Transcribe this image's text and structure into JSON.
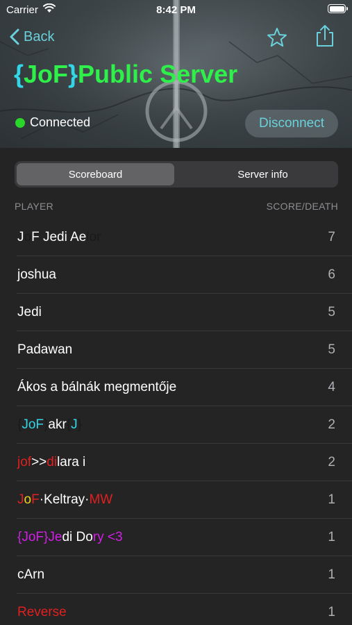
{
  "status_bar": {
    "carrier": "Carrier",
    "time": "8:42 PM"
  },
  "nav": {
    "back_label": "Back"
  },
  "server": {
    "title_segments": [
      {
        "text": "{",
        "color": "#33d6e6"
      },
      {
        "text": "JoF",
        "color": "#2ff04a"
      },
      {
        "text": "}",
        "color": "#33d6e6"
      },
      {
        "text": "Public Server",
        "color": "#2ff04a"
      }
    ],
    "status": "Connected",
    "disconnect_label": "Disconnect"
  },
  "tabs": {
    "active": "Scoreboard",
    "inactive": "Server info"
  },
  "columns": {
    "player": "PLAYER",
    "score": "SCORE/DEATH"
  },
  "colors": {
    "accent": "#6ad1dc",
    "connected": "#2bd62b",
    "background": "#242424"
  },
  "players": [
    {
      "score": "7",
      "name_segments": [
        {
          "text": "J",
          "color": "#ffffff"
        },
        {
          "text": "o",
          "color": "#1a1a1a"
        },
        {
          "text": "F Jedi Ae",
          "color": "#ffffff"
        },
        {
          "text": "lor",
          "color": "#1a1a1a"
        }
      ]
    },
    {
      "score": "6",
      "name_segments": [
        {
          "text": "joshua",
          "color": "#ffffff"
        }
      ]
    },
    {
      "score": "5",
      "name_segments": [
        {
          "text": "Jedi",
          "color": "#ffffff"
        }
      ]
    },
    {
      "score": "5",
      "name_segments": [
        {
          "text": "Padawan",
          "color": "#ffffff"
        }
      ]
    },
    {
      "score": "4",
      "name_segments": [
        {
          "text": "Ákos a bálnák megmentője",
          "color": "#ffffff"
        }
      ]
    },
    {
      "score": "2",
      "name_segments": [
        {
          "text": "{",
          "color": "#1a1a1a"
        },
        {
          "text": "JoF",
          "color": "#33d6e6"
        },
        {
          "text": "}",
          "color": "#1a1a1a"
        },
        {
          "text": "akr",
          "color": "#ffffff"
        },
        {
          "text": "{",
          "color": "#1a1a1a"
        },
        {
          "text": "J",
          "color": "#33d6e6"
        },
        {
          "text": "}",
          "color": "#1a1a1a"
        }
      ]
    },
    {
      "score": "2",
      "name_segments": [
        {
          "text": "jof",
          "color": "#e02020"
        },
        {
          "text": ">>",
          "color": "#ffffff"
        },
        {
          "text": "di",
          "color": "#e02020"
        },
        {
          "text": "lara i",
          "color": "#ffffff"
        }
      ]
    },
    {
      "score": "1",
      "name_segments": [
        {
          "text": "J",
          "color": "#e02020"
        },
        {
          "text": "o",
          "color": "#f0d21e"
        },
        {
          "text": "F",
          "color": "#e02020"
        },
        {
          "text": "·Keltray·",
          "color": "#ffffff"
        },
        {
          "text": "MW",
          "color": "#e02020"
        }
      ]
    },
    {
      "score": "1",
      "name_segments": [
        {
          "text": "{JoF}",
          "color": "#d21ee6"
        },
        {
          "text": "Je",
          "color": "#d21ee6"
        },
        {
          "text": "di Do",
          "color": "#ffffff"
        },
        {
          "text": "ry <3",
          "color": "#d21ee6"
        }
      ]
    },
    {
      "score": "1",
      "name_segments": [
        {
          "text": "cArn",
          "color": "#ffffff"
        }
      ]
    },
    {
      "score": "1",
      "name_segments": [
        {
          "text": "Reverse",
          "color": "#e02020"
        }
      ]
    }
  ]
}
